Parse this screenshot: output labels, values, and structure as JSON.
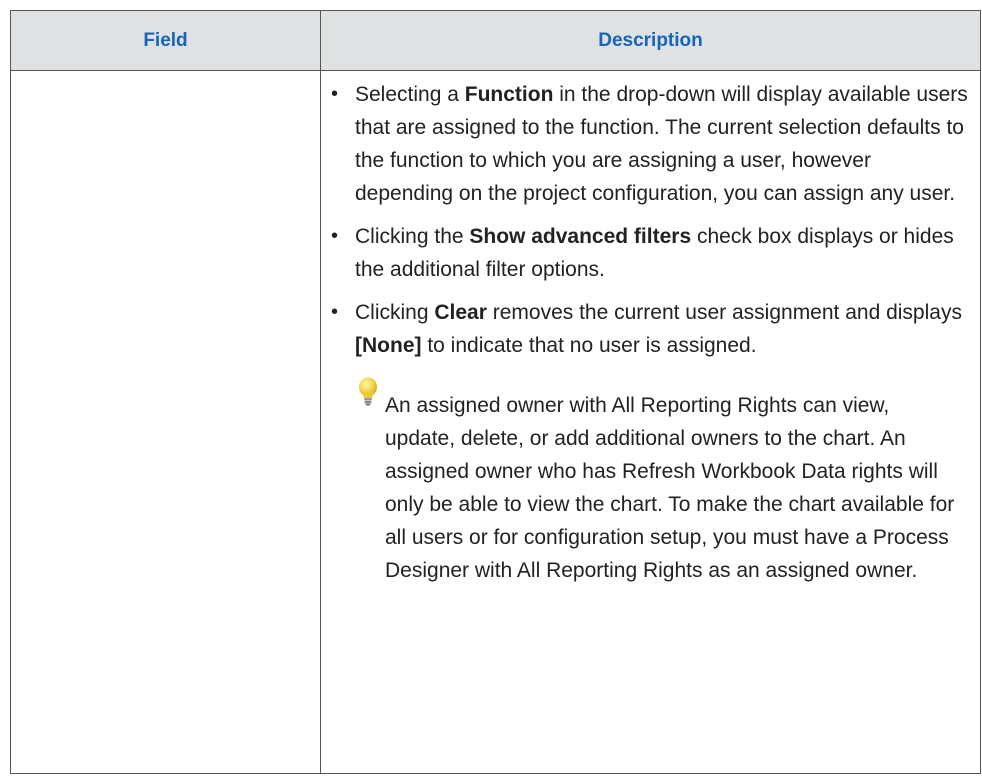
{
  "table": {
    "headers": {
      "field": "Field",
      "description": "Description"
    },
    "row": {
      "field": "",
      "bullets": [
        {
          "before": "Selecting a ",
          "bold": "Function",
          "after": " in the drop-down will display available users that are assigned to the function. The current selection defaults to the function to which you are assigning a user, however depending on the project configuration, you can assign any user."
        },
        {
          "before": "Clicking the ",
          "bold": "Show advanced filters",
          "after": " check box displays or hides the additional filter options."
        },
        {
          "before": "Clicking ",
          "bold": "Clear",
          "middle": " removes the current user assignment and displays ",
          "bold2": "[None]",
          "after": " to indicate that no user is assigned."
        }
      ],
      "bullet_glyph": "•",
      "tip": {
        "icon": "lightbulb-icon",
        "text": "An assigned owner with All Reporting Rights can view, update, delete, or add additional owners to the chart. An assigned owner who has Refresh Workbook Data rights will only be able to view the chart. To make the chart available for all users or for configuration setup, you must have a Process Designer with All Reporting Rights as an assigned owner."
      }
    }
  },
  "colors": {
    "header_text": "#1565b8",
    "header_bg": "#dfe1e3",
    "border": "#555555",
    "bulb": "#f5d547"
  }
}
